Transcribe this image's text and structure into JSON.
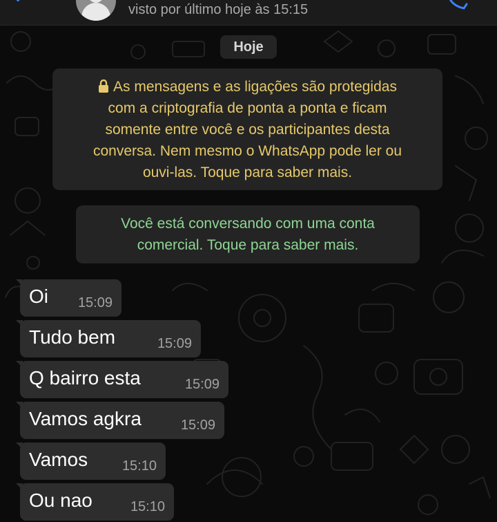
{
  "header": {
    "status": "visto por último hoje às 15:15"
  },
  "date_chip": "Hoje",
  "encryption_notice": {
    "lines": [
      "As mensagens e as ligações são protegidas",
      "com a criptografia de ponta a ponta e ficam",
      "somente entre você e os participantes desta",
      "conversa. Nem mesmo o WhatsApp pode ler ou",
      "ouvi-las. Toque para saber mais."
    ]
  },
  "business_notice": {
    "lines": [
      "Você está conversando com uma conta",
      "comercial. Toque para saber mais."
    ]
  },
  "messages": [
    {
      "text": "Oi",
      "time": "15:09"
    },
    {
      "text": "Tudo  bem",
      "time": "15:09"
    },
    {
      "text": "Q bairro  esta",
      "time": "15:09"
    },
    {
      "text": "Vamos agkra",
      "time": "15:09"
    },
    {
      "text": "Vamos",
      "time": "15:10"
    },
    {
      "text": "Ou  nao",
      "time": "15:10"
    }
  ],
  "colors": {
    "background": "#0b0b0b",
    "bubble": "#2d2d2d",
    "encryption_text": "#e6c96a",
    "business_text": "#8ed694",
    "accent": "#3b82f6"
  }
}
